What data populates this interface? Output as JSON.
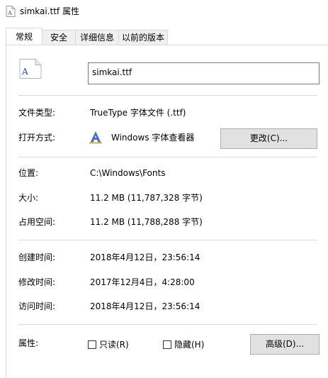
{
  "window": {
    "title": "simkai.ttf 属性"
  },
  "tabs": [
    {
      "label": "常规",
      "active": true
    },
    {
      "label": "安全",
      "active": false
    },
    {
      "label": "详细信息",
      "active": false
    },
    {
      "label": "以前的版本",
      "active": false
    }
  ],
  "file": {
    "name": "simkai.ttf",
    "icon": "font-file-icon"
  },
  "type": {
    "label": "文件类型:",
    "value": "TrueType 字体文件 (.ttf)"
  },
  "open_with": {
    "label": "打开方式:",
    "value": "Windows 字体查看器",
    "icon": "font-viewer-icon",
    "change_button": "更改(C)..."
  },
  "location": {
    "label": "位置:",
    "value": "C:\\Windows\\Fonts"
  },
  "size": {
    "label": "大小:",
    "value": "11.2 MB (11,787,328 字节)"
  },
  "size_on_disk": {
    "label": "占用空间:",
    "value": "11.2 MB (11,788,288 字节)"
  },
  "created": {
    "label": "创建时间:",
    "value": "2018年4月12日，23:56:14"
  },
  "modified": {
    "label": "修改时间:",
    "value": "2017年12月4日，4:28:00"
  },
  "accessed": {
    "label": "访问时间:",
    "value": "2018年4月12日，23:56:14"
  },
  "attributes": {
    "label": "属性:",
    "readonly": {
      "label": "只读(R)",
      "checked": false
    },
    "hidden": {
      "label": "隐藏(H)",
      "checked": false
    },
    "advanced_button": "高级(D)..."
  }
}
